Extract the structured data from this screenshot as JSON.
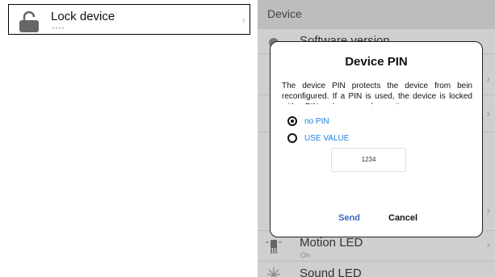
{
  "lock_row": {
    "title": "Lock device",
    "subtitle": "****",
    "chevron": "›"
  },
  "app": {
    "header": "Device",
    "rows": [
      {
        "title": "Software version",
        "subtitle": "",
        "icon": "gear-icon"
      },
      {
        "title": "Motion LED",
        "subtitle": "On",
        "icon": "led-icon"
      },
      {
        "title": "Sound LED",
        "subtitle": "",
        "icon": "sound-led-icon"
      }
    ]
  },
  "dialog": {
    "title": "Device PIN",
    "text": "The device PIN protects the device from bein reconfigured. If a PIN is used, the device is locked with a PIN and you can change it.",
    "options": [
      {
        "label": "no PIN",
        "selected": true
      },
      {
        "label": "USE VALUE",
        "selected": false
      }
    ],
    "pin_value": "1234",
    "send": "Send",
    "cancel": "Cancel"
  }
}
